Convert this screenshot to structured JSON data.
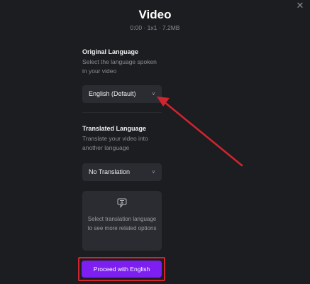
{
  "header": {
    "title": "Video",
    "meta": "0:00 · 1x1 · 7.2MB",
    "close_glyph": "✕"
  },
  "original_language": {
    "title": "Original Language",
    "description": "Select the language spoken in your video",
    "selected": "English (Default)"
  },
  "translated_language": {
    "title": "Translated Language",
    "description": "Translate your video into another language",
    "selected": "No Translation"
  },
  "info_box": {
    "text": "Select translation language to see more related options"
  },
  "proceed_button": {
    "label": "Proceed with English"
  },
  "colors": {
    "background": "#1c1d21",
    "panel": "#2b2c31",
    "accent": "#7d1ff0",
    "annotation": "#d0252f"
  }
}
